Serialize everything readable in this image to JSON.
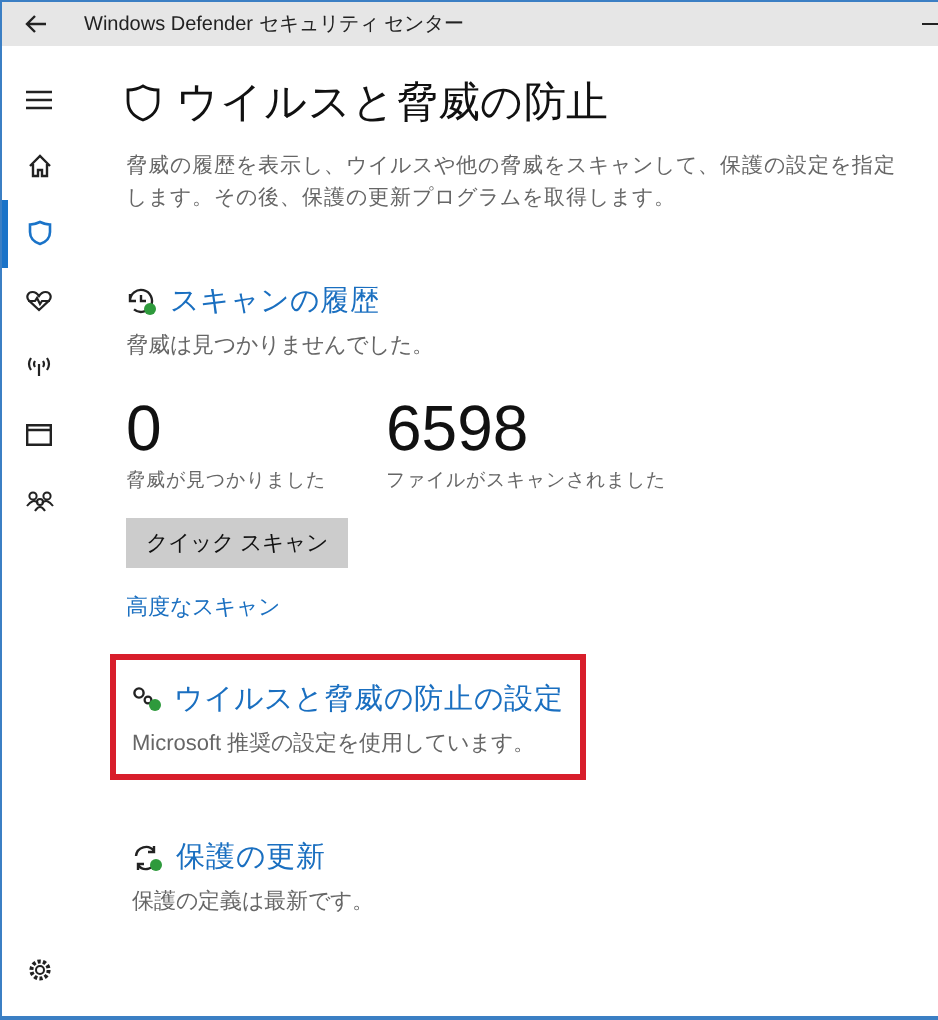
{
  "window": {
    "title": "Windows Defender セキュリティ センター"
  },
  "sidebar": {
    "items": [
      {
        "kind": "menu",
        "selected": false
      },
      {
        "kind": "home",
        "selected": false
      },
      {
        "kind": "shield",
        "selected": true
      },
      {
        "kind": "heart",
        "selected": false
      },
      {
        "kind": "wireless",
        "selected": false
      },
      {
        "kind": "window",
        "selected": false
      },
      {
        "kind": "family",
        "selected": false
      },
      {
        "kind": "settings",
        "selected": false
      }
    ]
  },
  "page": {
    "title": "ウイルスと脅威の防止",
    "description": "脅威の履歴を表示し、ウイルスや他の脅威をスキャンして、保護の設定を指定します。その後、保護の更新プログラムを取得します。"
  },
  "scan_history": {
    "heading": "スキャンの履歴",
    "status": "脅威は見つかりませんでした。",
    "stats": [
      {
        "value": "0",
        "label": "脅威が見つかりました"
      },
      {
        "value": "6598",
        "label": "ファイルがスキャンされました"
      }
    ],
    "button": "クイック スキャン",
    "link": "高度なスキャン"
  },
  "sections": [
    {
      "kind": "settings",
      "heading": "ウイルスと脅威の防止の設定",
      "text": "Microsoft 推奨の設定を使用しています。",
      "highlighted": true
    },
    {
      "kind": "update",
      "heading": "保護の更新",
      "text": "保護の定義は最新です。",
      "highlighted": false
    }
  ]
}
